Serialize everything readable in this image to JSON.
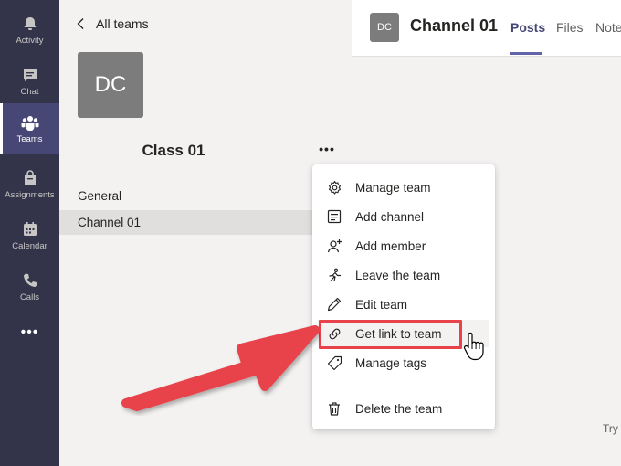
{
  "rail": {
    "items": [
      {
        "label": "Activity",
        "icon": "bell-icon"
      },
      {
        "label": "Chat",
        "icon": "chat-icon"
      },
      {
        "label": "Teams",
        "icon": "teams-icon",
        "active": true
      },
      {
        "label": "Assignments",
        "icon": "assignments-icon"
      },
      {
        "label": "Calendar",
        "icon": "calendar-icon"
      },
      {
        "label": "Calls",
        "icon": "phone-icon"
      }
    ],
    "more_label": "•••"
  },
  "team_panel": {
    "back_label": "All teams",
    "avatar_initials": "DC",
    "team_name": "Class 01",
    "more_label": "•••",
    "channels": [
      {
        "label": "General"
      },
      {
        "label": "Channel 01",
        "selected": true
      }
    ]
  },
  "main": {
    "channel_avatar": "DC",
    "channel_title": "Channel 01",
    "tabs": [
      {
        "label": "Posts",
        "active": true
      },
      {
        "label": "Files"
      },
      {
        "label": "Note"
      }
    ],
    "bottom_text": "Try"
  },
  "context_menu": {
    "items": [
      {
        "label": "Manage team",
        "icon": "gear-icon"
      },
      {
        "label": "Add channel",
        "icon": "add-channel-icon"
      },
      {
        "label": "Add member",
        "icon": "add-member-icon"
      },
      {
        "label": "Leave the team",
        "icon": "leave-icon"
      },
      {
        "label": "Edit team",
        "icon": "pencil-icon"
      },
      {
        "label": "Get link to team",
        "icon": "link-icon",
        "highlighted": true
      },
      {
        "label": "Manage tags",
        "icon": "tag-icon"
      },
      {
        "label": "Delete the team",
        "icon": "trash-icon"
      }
    ]
  },
  "colors": {
    "rail_bg": "#33344a",
    "accent": "#6264a7",
    "highlight_border": "#e8434b",
    "annotation_arrow": "#e8434b"
  }
}
